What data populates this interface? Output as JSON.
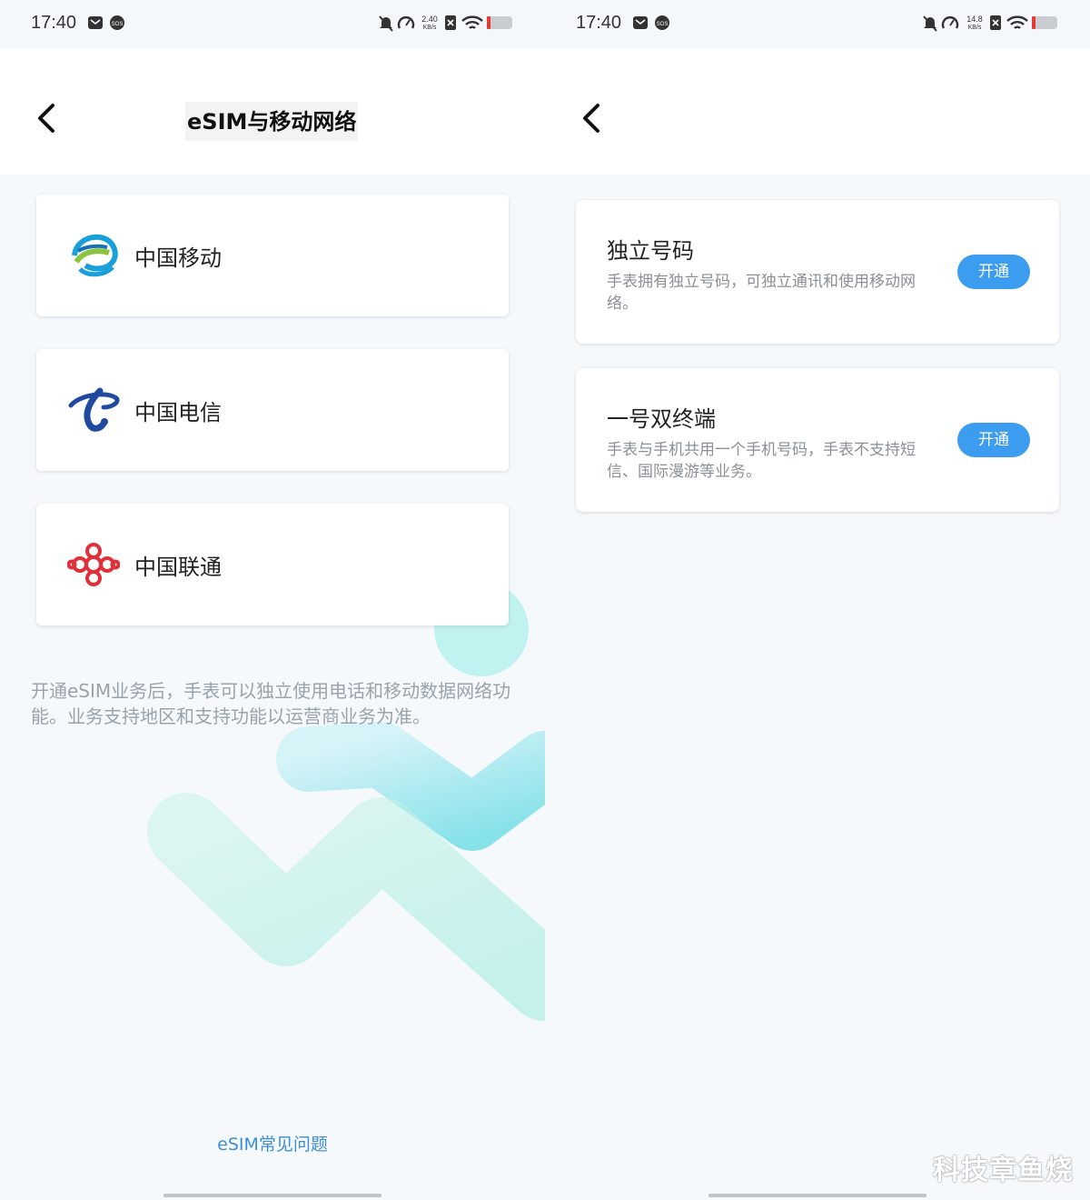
{
  "left": {
    "status": {
      "time": "17:40",
      "speed_value": "2.40",
      "speed_unit": "KB/s"
    },
    "header": {
      "title": "eSIM与移动网络"
    },
    "carriers": [
      {
        "name": "中国移动",
        "icon": "china-mobile-logo"
      },
      {
        "name": "中国电信",
        "icon": "china-telecom-logo"
      },
      {
        "name": "中国联通",
        "icon": "china-unicom-logo"
      }
    ],
    "info": "开通eSIM业务后，手表可以独立使用电话和移动数据网络功能。业务支持地区和支持功能以运营商业务为准。",
    "faq_link": "eSIM常见问题"
  },
  "right": {
    "status": {
      "time": "17:40",
      "speed_value": "14.8",
      "speed_unit": "KB/s"
    },
    "options": [
      {
        "title": "独立号码",
        "desc": "手表拥有独立号码，可独立通讯和使用移动网络。",
        "button": "开通"
      },
      {
        "title": "一号双终端",
        "desc": "手表与手机共用一个手机号码，手表不支持短信、国际漫游等业务。",
        "button": "开通"
      }
    ]
  },
  "watermark": "科技章鱼烧",
  "colors": {
    "accent": "#3b9cf0",
    "link": "#3c8fd6",
    "unicom_red": "#e0303a",
    "telecom_blue": "#1f4aa0"
  }
}
